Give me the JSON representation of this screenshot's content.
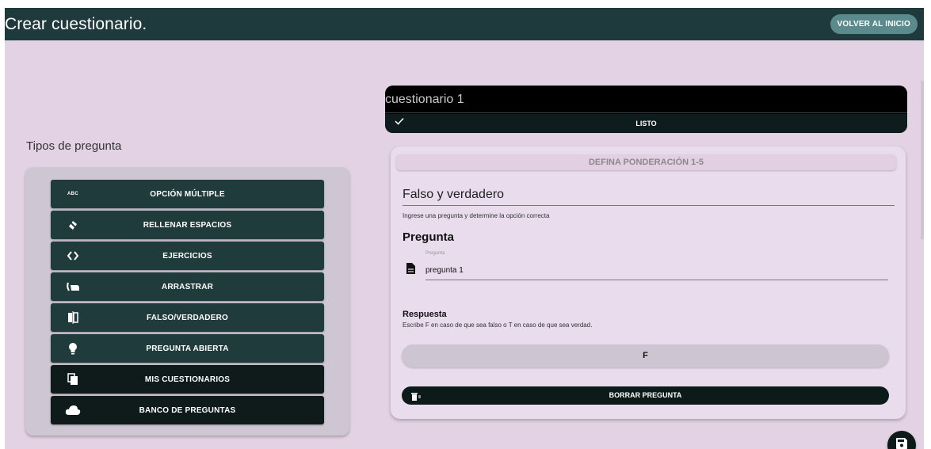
{
  "header": {
    "title": "Crear cuestionario.",
    "home_button": "VOLVER AL INICIO"
  },
  "sidebar": {
    "title": "Tipos de pregunta",
    "items": [
      {
        "label": "OPCIÓN MÚLTIPLE",
        "icon": "abc-icon",
        "icon_text": "ABC"
      },
      {
        "label": "RELLENAR ESPACIOS",
        "icon": "eraser-icon"
      },
      {
        "label": "EJERCICIOS",
        "icon": "code-icon"
      },
      {
        "label": "ARRASTRAR",
        "icon": "drag-hand-icon"
      },
      {
        "label": "FALSO/VERDADERO",
        "icon": "flip-icon"
      },
      {
        "label": "PREGUNTA ABIERTA",
        "icon": "lightbulb-icon"
      },
      {
        "label": "MIS CUESTIONARIOS",
        "icon": "files-icon"
      },
      {
        "label": "BANCO DE PREGUNTAS",
        "icon": "cloud-icon"
      }
    ]
  },
  "quiz": {
    "name": "cuestionario 1",
    "done_label": "LISTO"
  },
  "question": {
    "weight_button": "DEFINA PONDERACIÓN 1-5",
    "type": "Falso y verdadero",
    "help": "Ingrese una pregunta y determine la opción correcta",
    "heading": "Pregunta",
    "field_label": "Pregunta",
    "field_value": "pregunta 1",
    "answer_heading": "Respuesta",
    "answer_help": "Escribe F en caso de que sea falso o T en caso de que sea verdad.",
    "answer_value": "F",
    "delete_button": "BORRAR PREGUNTA"
  },
  "colors": {
    "appbar": "#1e3a3c",
    "background": "#e3d2e3",
    "button": "#1f3b3c",
    "button_dark": "#0f1a1b"
  }
}
